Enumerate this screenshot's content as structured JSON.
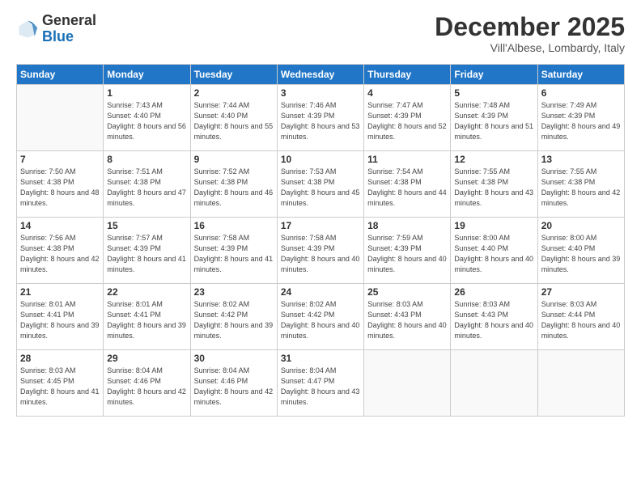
{
  "header": {
    "logo_general": "General",
    "logo_blue": "Blue",
    "month": "December 2025",
    "location": "Vill'Albese, Lombardy, Italy"
  },
  "weekdays": [
    "Sunday",
    "Monday",
    "Tuesday",
    "Wednesday",
    "Thursday",
    "Friday",
    "Saturday"
  ],
  "weeks": [
    [
      {
        "day": "",
        "sunrise": "",
        "sunset": "",
        "daylight": ""
      },
      {
        "day": "1",
        "sunrise": "Sunrise: 7:43 AM",
        "sunset": "Sunset: 4:40 PM",
        "daylight": "Daylight: 8 hours and 56 minutes."
      },
      {
        "day": "2",
        "sunrise": "Sunrise: 7:44 AM",
        "sunset": "Sunset: 4:40 PM",
        "daylight": "Daylight: 8 hours and 55 minutes."
      },
      {
        "day": "3",
        "sunrise": "Sunrise: 7:46 AM",
        "sunset": "Sunset: 4:39 PM",
        "daylight": "Daylight: 8 hours and 53 minutes."
      },
      {
        "day": "4",
        "sunrise": "Sunrise: 7:47 AM",
        "sunset": "Sunset: 4:39 PM",
        "daylight": "Daylight: 8 hours and 52 minutes."
      },
      {
        "day": "5",
        "sunrise": "Sunrise: 7:48 AM",
        "sunset": "Sunset: 4:39 PM",
        "daylight": "Daylight: 8 hours and 51 minutes."
      },
      {
        "day": "6",
        "sunrise": "Sunrise: 7:49 AM",
        "sunset": "Sunset: 4:39 PM",
        "daylight": "Daylight: 8 hours and 49 minutes."
      }
    ],
    [
      {
        "day": "7",
        "sunrise": "Sunrise: 7:50 AM",
        "sunset": "Sunset: 4:38 PM",
        "daylight": "Daylight: 8 hours and 48 minutes."
      },
      {
        "day": "8",
        "sunrise": "Sunrise: 7:51 AM",
        "sunset": "Sunset: 4:38 PM",
        "daylight": "Daylight: 8 hours and 47 minutes."
      },
      {
        "day": "9",
        "sunrise": "Sunrise: 7:52 AM",
        "sunset": "Sunset: 4:38 PM",
        "daylight": "Daylight: 8 hours and 46 minutes."
      },
      {
        "day": "10",
        "sunrise": "Sunrise: 7:53 AM",
        "sunset": "Sunset: 4:38 PM",
        "daylight": "Daylight: 8 hours and 45 minutes."
      },
      {
        "day": "11",
        "sunrise": "Sunrise: 7:54 AM",
        "sunset": "Sunset: 4:38 PM",
        "daylight": "Daylight: 8 hours and 44 minutes."
      },
      {
        "day": "12",
        "sunrise": "Sunrise: 7:55 AM",
        "sunset": "Sunset: 4:38 PM",
        "daylight": "Daylight: 8 hours and 43 minutes."
      },
      {
        "day": "13",
        "sunrise": "Sunrise: 7:55 AM",
        "sunset": "Sunset: 4:38 PM",
        "daylight": "Daylight: 8 hours and 42 minutes."
      }
    ],
    [
      {
        "day": "14",
        "sunrise": "Sunrise: 7:56 AM",
        "sunset": "Sunset: 4:38 PM",
        "daylight": "Daylight: 8 hours and 42 minutes."
      },
      {
        "day": "15",
        "sunrise": "Sunrise: 7:57 AM",
        "sunset": "Sunset: 4:39 PM",
        "daylight": "Daylight: 8 hours and 41 minutes."
      },
      {
        "day": "16",
        "sunrise": "Sunrise: 7:58 AM",
        "sunset": "Sunset: 4:39 PM",
        "daylight": "Daylight: 8 hours and 41 minutes."
      },
      {
        "day": "17",
        "sunrise": "Sunrise: 7:58 AM",
        "sunset": "Sunset: 4:39 PM",
        "daylight": "Daylight: 8 hours and 40 minutes."
      },
      {
        "day": "18",
        "sunrise": "Sunrise: 7:59 AM",
        "sunset": "Sunset: 4:39 PM",
        "daylight": "Daylight: 8 hours and 40 minutes."
      },
      {
        "day": "19",
        "sunrise": "Sunrise: 8:00 AM",
        "sunset": "Sunset: 4:40 PM",
        "daylight": "Daylight: 8 hours and 40 minutes."
      },
      {
        "day": "20",
        "sunrise": "Sunrise: 8:00 AM",
        "sunset": "Sunset: 4:40 PM",
        "daylight": "Daylight: 8 hours and 39 minutes."
      }
    ],
    [
      {
        "day": "21",
        "sunrise": "Sunrise: 8:01 AM",
        "sunset": "Sunset: 4:41 PM",
        "daylight": "Daylight: 8 hours and 39 minutes."
      },
      {
        "day": "22",
        "sunrise": "Sunrise: 8:01 AM",
        "sunset": "Sunset: 4:41 PM",
        "daylight": "Daylight: 8 hours and 39 minutes."
      },
      {
        "day": "23",
        "sunrise": "Sunrise: 8:02 AM",
        "sunset": "Sunset: 4:42 PM",
        "daylight": "Daylight: 8 hours and 39 minutes."
      },
      {
        "day": "24",
        "sunrise": "Sunrise: 8:02 AM",
        "sunset": "Sunset: 4:42 PM",
        "daylight": "Daylight: 8 hours and 40 minutes."
      },
      {
        "day": "25",
        "sunrise": "Sunrise: 8:03 AM",
        "sunset": "Sunset: 4:43 PM",
        "daylight": "Daylight: 8 hours and 40 minutes."
      },
      {
        "day": "26",
        "sunrise": "Sunrise: 8:03 AM",
        "sunset": "Sunset: 4:43 PM",
        "daylight": "Daylight: 8 hours and 40 minutes."
      },
      {
        "day": "27",
        "sunrise": "Sunrise: 8:03 AM",
        "sunset": "Sunset: 4:44 PM",
        "daylight": "Daylight: 8 hours and 40 minutes."
      }
    ],
    [
      {
        "day": "28",
        "sunrise": "Sunrise: 8:03 AM",
        "sunset": "Sunset: 4:45 PM",
        "daylight": "Daylight: 8 hours and 41 minutes."
      },
      {
        "day": "29",
        "sunrise": "Sunrise: 8:04 AM",
        "sunset": "Sunset: 4:46 PM",
        "daylight": "Daylight: 8 hours and 42 minutes."
      },
      {
        "day": "30",
        "sunrise": "Sunrise: 8:04 AM",
        "sunset": "Sunset: 4:46 PM",
        "daylight": "Daylight: 8 hours and 42 minutes."
      },
      {
        "day": "31",
        "sunrise": "Sunrise: 8:04 AM",
        "sunset": "Sunset: 4:47 PM",
        "daylight": "Daylight: 8 hours and 43 minutes."
      },
      {
        "day": "",
        "sunrise": "",
        "sunset": "",
        "daylight": ""
      },
      {
        "day": "",
        "sunrise": "",
        "sunset": "",
        "daylight": ""
      },
      {
        "day": "",
        "sunrise": "",
        "sunset": "",
        "daylight": ""
      }
    ]
  ]
}
